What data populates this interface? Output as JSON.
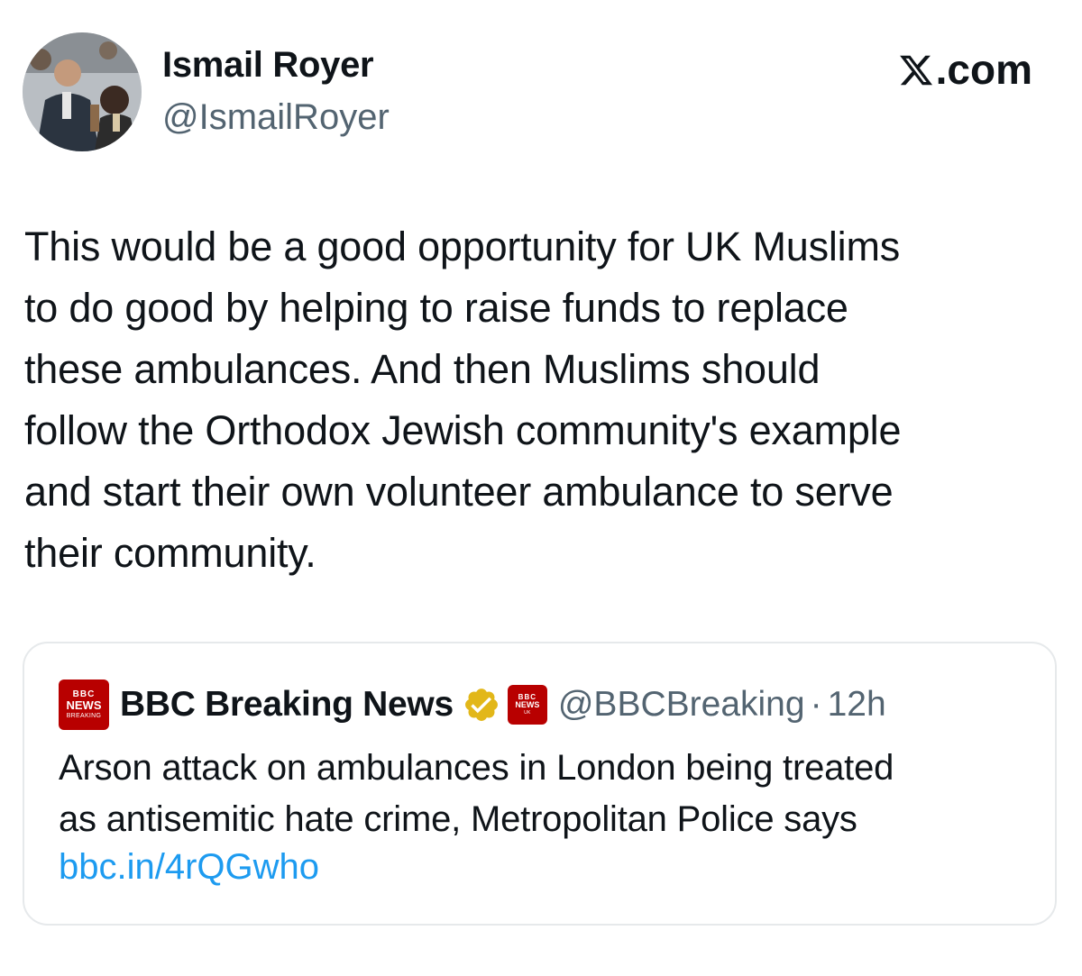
{
  "author": {
    "display_name": "Ismail Royer",
    "handle": "@IsmailRoyer"
  },
  "brand": {
    "label": ".com",
    "icon": "x-logo-icon"
  },
  "tweet": {
    "lines": [
      "This would be a good opportunity for UK Muslims",
      "to do good by helping to raise funds to replace",
      "these ambulances. And then Muslims should",
      "follow the Orthodox Jewish community's example",
      "and start their own volunteer ambulance to serve",
      "their community."
    ]
  },
  "quote": {
    "logo": {
      "line1": "BBC",
      "line2": "NEWS",
      "line3": "BREAKING"
    },
    "small_logo": {
      "line1": "BBC",
      "line2": "NEWS",
      "line3": "UK"
    },
    "display_name": "BBC Breaking News",
    "handle": "@BBCBreaking",
    "separator": "·",
    "time": "12h",
    "text_lines": [
      "Arson attack on ambulances in London being treated",
      "as antisemitic hate crime, Metropolitan Police says"
    ],
    "link": "bbc.in/4rQGwho"
  },
  "colors": {
    "text": "#0f1419",
    "secondary": "#536471",
    "link": "#1d9bf0",
    "bbc_red": "#b80000",
    "verified_gold": "#e2b719",
    "card_border": "#e6e9eb"
  }
}
